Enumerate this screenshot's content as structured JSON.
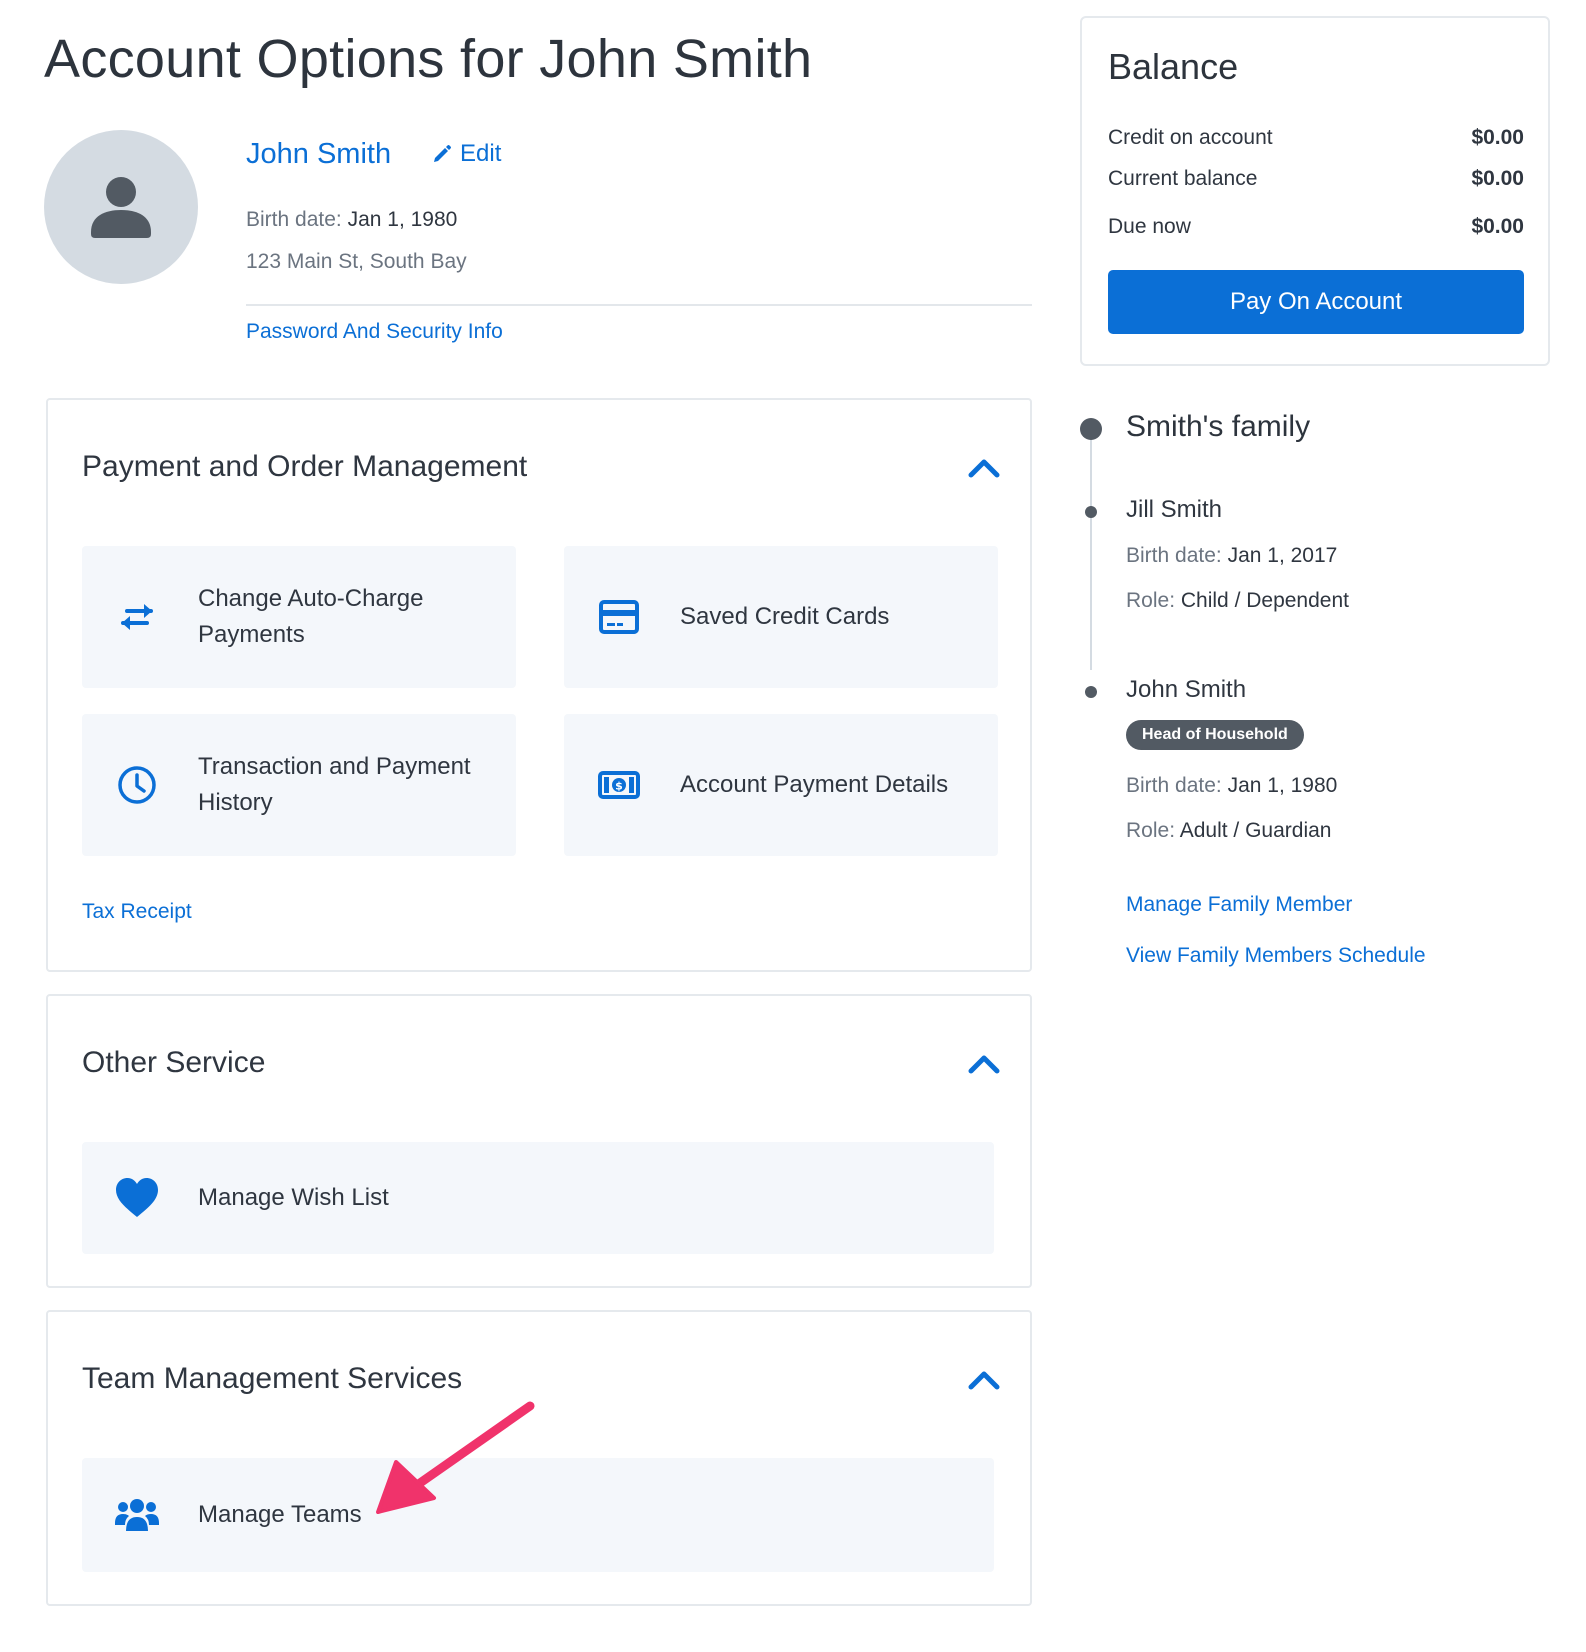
{
  "page": {
    "title": "Account Options for John Smith"
  },
  "profile": {
    "name": "John Smith",
    "edit_label": "Edit",
    "birth_label": "Birth date:",
    "birth_value": "Jan 1, 1980",
    "address": "123 Main St, South Bay",
    "security_link": "Password And Security Info"
  },
  "sections": {
    "payment": {
      "title": "Payment and Order Management",
      "tiles": [
        {
          "label_line1": "Change Auto-Charge",
          "label_line2": "Payments",
          "icon": "swap-arrows-icon"
        },
        {
          "label_line1": "Saved Credit Cards",
          "icon": "credit-card-icon"
        },
        {
          "label_line1": "Transaction and Payment",
          "label_line2": "History",
          "icon": "clock-icon"
        },
        {
          "label_line1": "Account Payment Details",
          "icon": "cash-icon"
        }
      ],
      "tax_link": "Tax Receipt"
    },
    "other": {
      "title": "Other Service",
      "tiles": [
        {
          "label": "Manage Wish List",
          "icon": "heart-icon"
        }
      ]
    },
    "team": {
      "title": "Team Management Services",
      "tiles": [
        {
          "label": "Manage Teams",
          "icon": "users-icon"
        }
      ]
    }
  },
  "balance": {
    "title": "Balance",
    "rows": [
      {
        "label": "Credit on account",
        "amount": "$0.00"
      },
      {
        "label": "Current balance",
        "amount": "$0.00"
      },
      {
        "label": "Due now",
        "amount": "$0.00"
      }
    ],
    "pay_button": "Pay On Account"
  },
  "family": {
    "title": "Smith's family",
    "members": [
      {
        "name": "Jill Smith",
        "birth_label": "Birth date:",
        "birth_value": "Jan 1, 2017",
        "role_label": "Role:",
        "role_value": "Child / Dependent"
      },
      {
        "name": "John Smith",
        "badge": "Head of Household",
        "birth_label": "Birth date:",
        "birth_value": "Jan 1, 1980",
        "role_label": "Role:",
        "role_value": "Adult / Guardian"
      }
    ],
    "manage_link": "Manage Family Member",
    "schedule_link": "View Family Members Schedule"
  },
  "colors": {
    "accent": "#0b6fd6",
    "annotation": "#f0336b",
    "tile_bg": "#f4f7fb",
    "badge_bg": "#525a63"
  }
}
